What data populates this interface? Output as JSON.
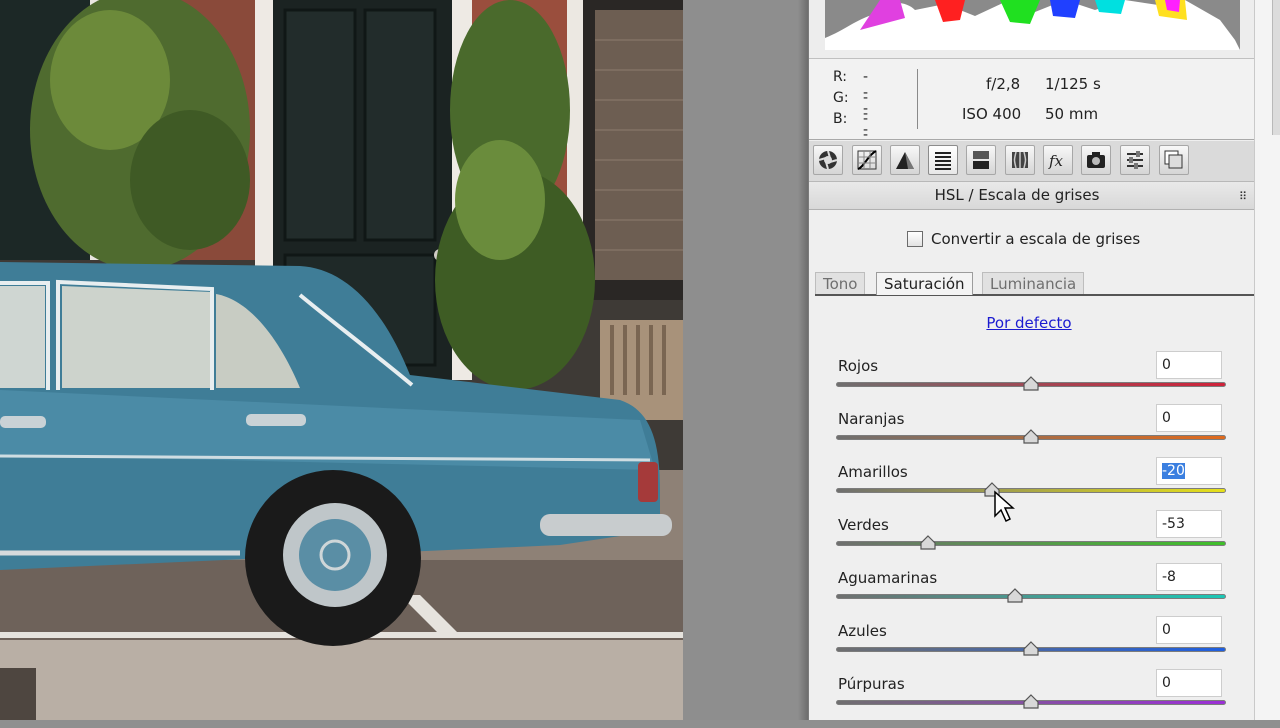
{
  "histogram": {
    "label": "histogram"
  },
  "info": {
    "r_label": "R:",
    "r_value": "---",
    "g_label": "G:",
    "g_value": "---",
    "b_label": "B:",
    "b_value": "---",
    "aperture": "f/2,8",
    "shutter": "1/125 s",
    "iso": "ISO 400",
    "focal": "50 mm"
  },
  "toolbar": {
    "icons": [
      "basic-icon",
      "tone-curve-icon",
      "detail-icon",
      "hsl-icon",
      "split-toning-icon",
      "lens-corrections-icon",
      "effects-icon",
      "camera-calibration-icon",
      "presets-icon",
      "snapshots-icon"
    ]
  },
  "section": {
    "title": "HSL / Escala de grises",
    "menu_glyph": "☰"
  },
  "grayscale": {
    "label": "Convertir a escala de grises",
    "checked": false
  },
  "tabs": [
    "Tono",
    "Saturación",
    "Luminancia"
  ],
  "selected_tab": "Saturación",
  "default_link": "Por defecto",
  "sliders": [
    {
      "name": "Rojos",
      "value": "0",
      "selected": false,
      "colors": [
        "#6f6f6f",
        "#d0223a"
      ]
    },
    {
      "name": "Naranjas",
      "value": "0",
      "selected": false,
      "colors": [
        "#6f6f6f",
        "#e06a1c"
      ]
    },
    {
      "name": "Amarillos",
      "value": "-20",
      "selected": true,
      "colors": [
        "#6f6f6f",
        "#e6e01a"
      ]
    },
    {
      "name": "Verdes",
      "value": "-53",
      "selected": false,
      "colors": [
        "#6f6f6f",
        "#3fbf2a"
      ]
    },
    {
      "name": "Aguamarinas",
      "value": "-8",
      "selected": false,
      "colors": [
        "#6f6f6f",
        "#1cc7b5"
      ]
    },
    {
      "name": "Azules",
      "value": "0",
      "selected": false,
      "colors": [
        "#6f6f6f",
        "#1f5fe0"
      ]
    },
    {
      "name": "Púrpuras",
      "value": "0",
      "selected": false,
      "colors": [
        "#6f6f6f",
        "#9b2fd6"
      ]
    }
  ],
  "slider_range": [
    -100,
    100
  ]
}
